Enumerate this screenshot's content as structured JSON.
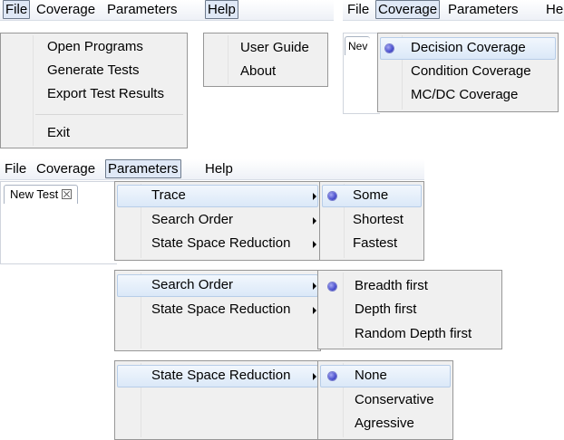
{
  "menubar": {
    "file": "File",
    "coverage": "Coverage",
    "parameters": "Parameters",
    "help": "Help",
    "help_truncated": "Help"
  },
  "file_menu": {
    "items": [
      "Open Programs",
      "Generate Tests",
      "Export Test Results"
    ],
    "exit": "Exit"
  },
  "help_menu": {
    "items": [
      "User Guide",
      "About"
    ]
  },
  "coverage_menu": {
    "selected": "Decision Coverage",
    "items": [
      "Decision Coverage",
      "Condition Coverage",
      "MC/DC Coverage"
    ]
  },
  "tabs": {
    "new_test": "New Test",
    "new_test_truncated": "Nev"
  },
  "parameters_menu": {
    "items": [
      "Trace",
      "Search Order",
      "State Space Reduction"
    ]
  },
  "trace_submenu": {
    "selected": "Some",
    "items": [
      "Some",
      "Shortest",
      "Fastest"
    ]
  },
  "search_order_submenu": {
    "selected": "Breadth first",
    "items": [
      "Breadth first",
      "Depth first",
      "Random Depth first"
    ]
  },
  "state_space_submenu": {
    "selected": "None",
    "items": [
      "None",
      "Conservative",
      "Agressive"
    ]
  },
  "colors": {
    "highlight": "#dbe8f8",
    "highlight_border": "#b7cde8",
    "radio": "#4a4fcf",
    "menu_bg": "#f0f0f0"
  }
}
